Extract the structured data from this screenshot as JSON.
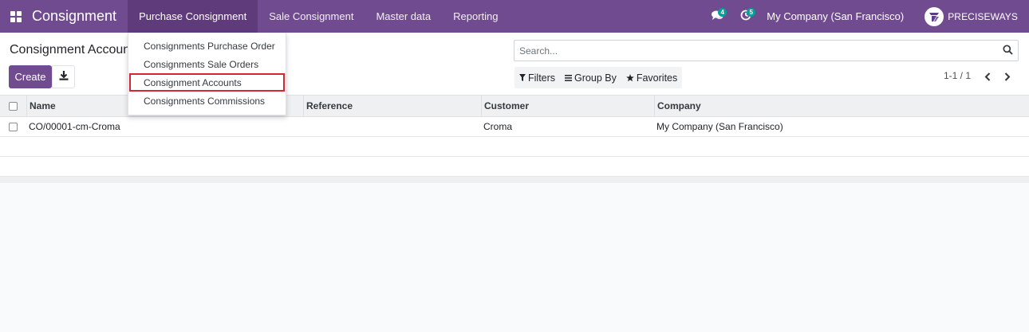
{
  "navbar": {
    "app_name": "Consignment",
    "menus": [
      "Purchase Consignment",
      "Sale Consignment",
      "Master data",
      "Reporting"
    ],
    "active_menu": "Purchase Consignment",
    "messages_badge": "4",
    "activities_badge": "5",
    "company": "My Company (San Francisco)",
    "user": "PRECISEWAYS",
    "accent_color": "#714b8f"
  },
  "dropdown": {
    "items": [
      "Consignments Purchase Order",
      "Consignments Sale Orders",
      "Consignment Accounts",
      "Consignments Commissions"
    ],
    "highlighted_item": "Consignment Accounts"
  },
  "control_panel": {
    "breadcrumb": "Consignment Accounts",
    "create_label": "Create",
    "download_icon": "download-icon",
    "search_placeholder": "Search...",
    "filters_label": "Filters",
    "group_by_label": "Group By",
    "favorites_label": "Favorites",
    "pager": "1-1 / 1"
  },
  "list": {
    "columns": [
      "Name",
      "Reference",
      "Customer",
      "Company"
    ],
    "rows": [
      {
        "name": "CO/00001-cm-Croma",
        "reference": "",
        "customer": "Croma",
        "company": "My Company (San Francisco)"
      }
    ]
  }
}
